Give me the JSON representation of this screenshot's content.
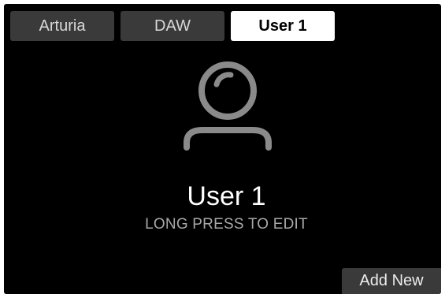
{
  "tabs": [
    {
      "label": "Arturia",
      "active": false
    },
    {
      "label": "DAW",
      "active": false
    },
    {
      "label": "User 1",
      "active": true
    }
  ],
  "profile": {
    "icon": "user-icon",
    "name": "User 1",
    "hint": "LONG PRESS TO EDIT"
  },
  "actions": {
    "add_new_label": "Add New"
  },
  "colors": {
    "background": "#000000",
    "tab_inactive": "#3a3a3a",
    "tab_active": "#ffffff",
    "icon": "#8a8a8a"
  }
}
